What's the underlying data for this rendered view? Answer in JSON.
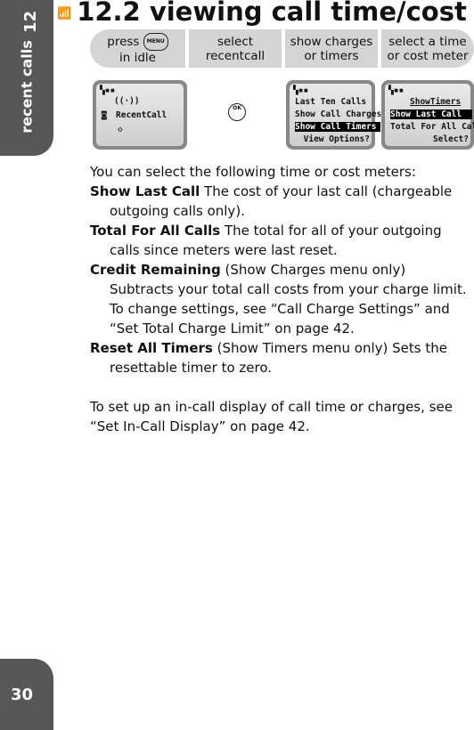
{
  "sidebar": {
    "chapter_number": "12",
    "chapter_label": "recent calls",
    "page_number": "30"
  },
  "header": {
    "title": "12.2 viewing call time/cost",
    "icon": "antenna-icon"
  },
  "steps": [
    {
      "line1": "press",
      "key": "MENU",
      "line2": "in idle"
    },
    {
      "line1": "select",
      "line2": "recentcall"
    },
    {
      "line1": "show charges",
      "line2": "or timers"
    },
    {
      "line1": "select a time",
      "line2": "or cost meter"
    }
  ],
  "screens": {
    "s1": {
      "item": "RecentCall"
    },
    "ok_key": "OK",
    "s2": {
      "items": [
        "Last Ten Calls",
        "Show Call Charges",
        "Show Call Timers"
      ],
      "softkey": "View Options?"
    },
    "s3": {
      "title": "ShowTimers",
      "items": [
        "Show Last Call",
        "Total For All Call"
      ],
      "softkey": "Select?"
    }
  },
  "body": {
    "intro": "You can select the following time or cost meters:",
    "defs": [
      {
        "term": "Show Last Call",
        "text": "  The cost of your last call (chargeable outgoing calls only)."
      },
      {
        "term": "Total For All Calls",
        "text": "  The total for all of your outgoing calls since meters were last reset."
      },
      {
        "term": "Credit Remaining",
        "text": "  (Show Charges menu only) Subtracts your total call costs from your charge limit. To change settings, see “Call Charge Settings” and “Set Total Charge Limit” on page 42."
      },
      {
        "term": "Reset All Timers",
        "text": "  (Show Timers menu only) Sets the resettable timer to zero."
      }
    ],
    "outro": "To set up an in-call display of call time or charges, see “Set In-Call Display” on page 42."
  }
}
